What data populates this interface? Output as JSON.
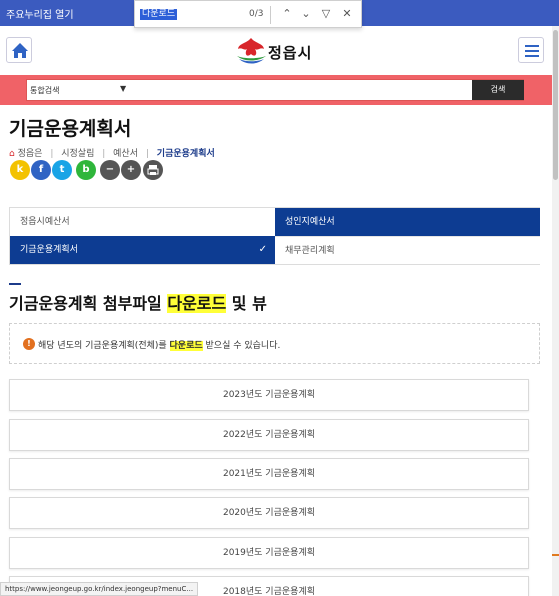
{
  "topbar": {
    "toggle_label": "주요누리집 열기"
  },
  "findbar": {
    "query": "다운로드",
    "count": "0/3"
  },
  "header": {
    "logo_text": "정읍시"
  },
  "search": {
    "category": "통합검색",
    "button_label": "검색"
  },
  "page": {
    "title": "기금운용계획서"
  },
  "breadcrumb": [
    "정읍은",
    "시정살림",
    "예산서",
    "기금운용계획서"
  ],
  "share": [
    {
      "icon": "kakaostory-icon",
      "letter": "k",
      "color": "#f3c200"
    },
    {
      "icon": "facebook-icon",
      "letter": "f",
      "color": "#2f63c4"
    },
    {
      "icon": "twitter-icon",
      "letter": "t",
      "color": "#19a4e6"
    },
    {
      "icon": "band-icon",
      "letter": "b",
      "color": "#2fb63b"
    },
    {
      "icon": "zoom-out-icon",
      "letter": "−",
      "color": "#555555"
    },
    {
      "icon": "zoom-in-icon",
      "letter": "+",
      "color": "#555555"
    },
    {
      "icon": "print-icon",
      "letter": "",
      "color": "#555555"
    }
  ],
  "tabs": [
    {
      "label": "정읍시예산서",
      "active": false
    },
    {
      "label": "성인지예산서",
      "active": true
    },
    {
      "label": "기금운용계획서",
      "active": true
    },
    {
      "label": "채무관리계획",
      "active": false
    }
  ],
  "section": {
    "title_before": "기금운용계획 첨부파일 ",
    "title_highlight": "다운로드",
    "title_after": " 및 뷰"
  },
  "notice": {
    "before": "해당 년도의 기금운용계획(전체)를 ",
    "highlight": "다운로드",
    "after": " 받으실 수 있습니다."
  },
  "years": [
    "2023년도 기금운용계획",
    "2022년도 기금운용계획",
    "2021년도 기금운용계획",
    "2020년도 기금운용계획",
    "2019년도 기금운용계획",
    "2018년도 기금운용계획"
  ],
  "status": {
    "url": "https://www.jeongeup.go.kr/index.jeongeup?menuC..."
  },
  "colors": {
    "brand_blue": "#0d3c92",
    "search_band": "#f06267",
    "highlight": "#ffff38"
  }
}
